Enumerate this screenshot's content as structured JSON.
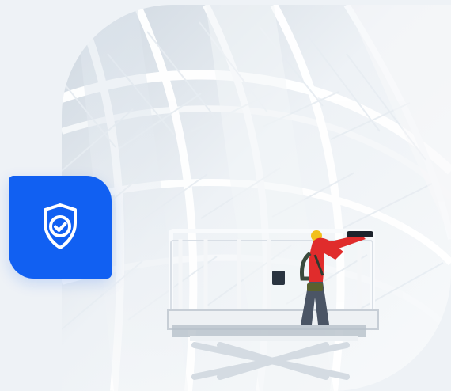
{
  "scene": {
    "photo": "worker-on-lift-photo",
    "badge_icon": "shield-check-icon",
    "colors": {
      "background": "#eef2f6",
      "badge": "#1160f2",
      "dome_panel": "#dfe8f0",
      "frame": "#f8fafc",
      "worker_shirt": "#e02c2c",
      "helmet": "#f2c01b"
    }
  }
}
